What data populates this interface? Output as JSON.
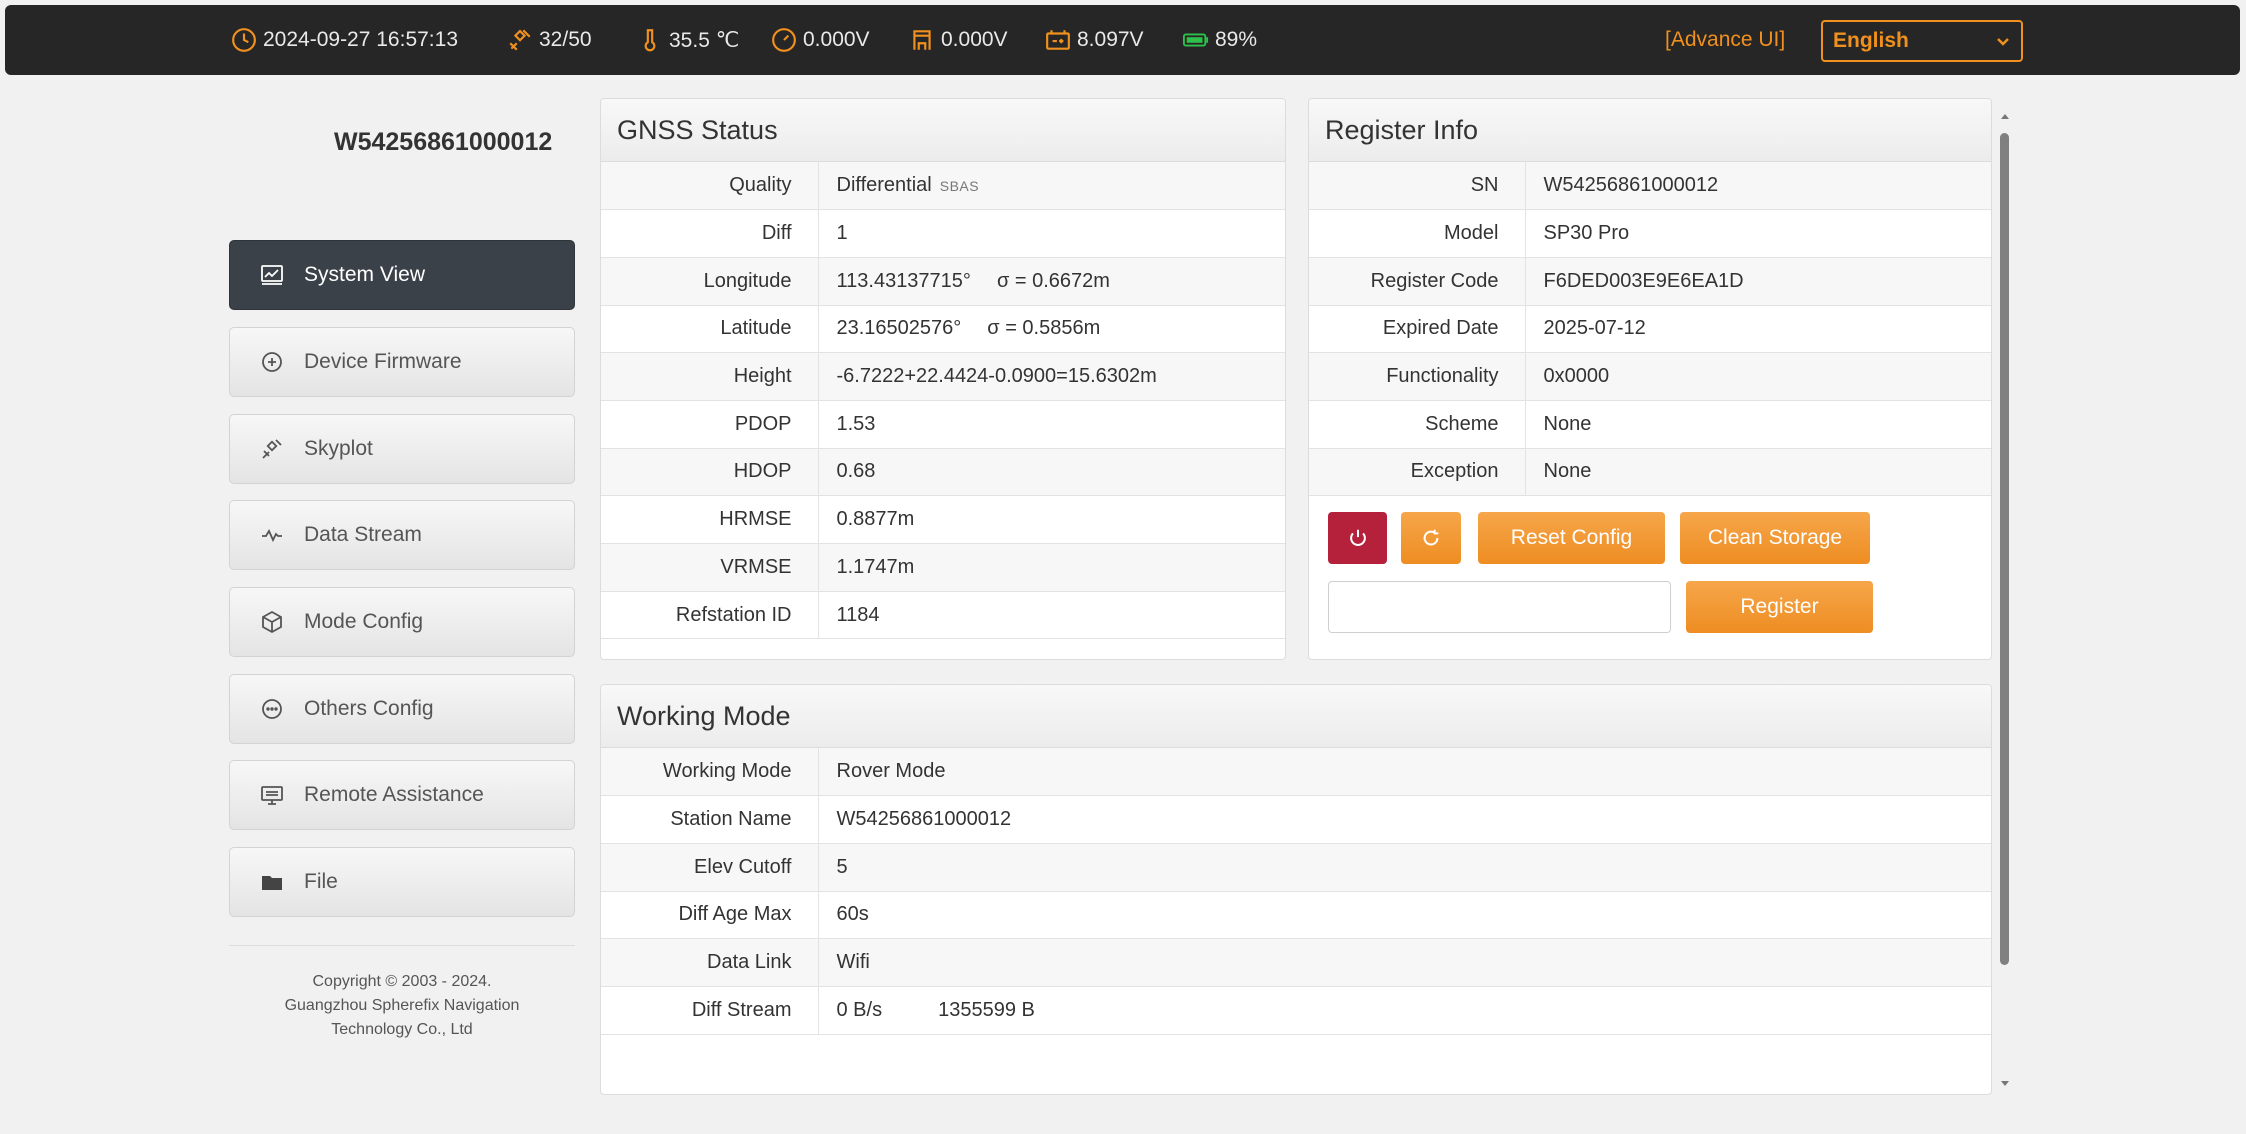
{
  "topbar": {
    "datetime": "2024-09-27 16:57:13",
    "satellites": "32/50",
    "temperature": "35.5 ℃",
    "voltage_1": "0.000V",
    "voltage_2": "0.000V",
    "voltage_3": "8.097V",
    "battery": "89%",
    "advance_ui": "[Advance UI]",
    "language": "English"
  },
  "sidebar": {
    "device_sn": "W54256861000012",
    "items": [
      {
        "label": "System View",
        "icon": "chart-icon"
      },
      {
        "label": "Device Firmware",
        "icon": "firmware-icon"
      },
      {
        "label": "Skyplot",
        "icon": "satellite-icon"
      },
      {
        "label": "Data Stream",
        "icon": "wave-icon"
      },
      {
        "label": "Mode Config",
        "icon": "cube-icon"
      },
      {
        "label": "Others Config",
        "icon": "more-icon"
      },
      {
        "label": "Remote Assistance",
        "icon": "monitor-icon"
      },
      {
        "label": "File",
        "icon": "folder-icon"
      }
    ],
    "copyright": [
      "Copyright © 2003 - 2024.",
      "Guangzhou Spherefix Navigation",
      "Technology Co., Ltd"
    ]
  },
  "gnss": {
    "title": "GNSS Status",
    "quality_label": "Quality",
    "quality_value": "Differential",
    "quality_sub": "SBAS",
    "diff_label": "Diff",
    "diff_value": "1",
    "longitude_label": "Longitude",
    "longitude_value": "113.43137715°",
    "longitude_sigma": "σ = 0.6672m",
    "latitude_label": "Latitude",
    "latitude_value": "23.16502576°",
    "latitude_sigma": "σ = 0.5856m",
    "height_label": "Height",
    "height_value": "-6.7222+22.4424-0.0900=15.6302m",
    "pdop_label": "PDOP",
    "pdop_value": "1.53",
    "hdop_label": "HDOP",
    "hdop_value": "0.68",
    "hrmse_label": "HRMSE",
    "hrmse_value": "0.8877m",
    "vrmse_label": "VRMSE",
    "vrmse_value": "1.1747m",
    "refstation_label": "Refstation ID",
    "refstation_value": "1184"
  },
  "register": {
    "title": "Register Info",
    "rows": [
      {
        "k": "SN",
        "v": "W54256861000012"
      },
      {
        "k": "Model",
        "v": "SP30 Pro"
      },
      {
        "k": "Register Code",
        "v": "F6DED003E9E6EA1D"
      },
      {
        "k": "Expired Date",
        "v": "2025-07-12"
      },
      {
        "k": "Functionality",
        "v": "0x0000"
      },
      {
        "k": "Scheme",
        "v": "None"
      },
      {
        "k": "Exception",
        "v": "None"
      }
    ],
    "reset_config": "Reset Config",
    "clean_storage": "Clean Storage",
    "register_button": "Register",
    "input_value": ""
  },
  "working": {
    "title": "Working Mode",
    "rows": [
      {
        "k": "Working Mode",
        "v": "Rover Mode"
      },
      {
        "k": "Station Name",
        "v": "W54256861000012"
      },
      {
        "k": "Elev Cutoff",
        "v": "5"
      },
      {
        "k": "Diff Age Max",
        "v": "60s"
      },
      {
        "k": "Data Link",
        "v": "Wifi"
      }
    ],
    "diff_stream_label": "Diff Stream",
    "diff_stream_rate": "0 B/s",
    "diff_stream_total": "1355599 B"
  },
  "colors": {
    "accent": "#f0901e",
    "topbar": "#262626",
    "active_nav": "#3b4148",
    "power_button": "#b5203a"
  }
}
